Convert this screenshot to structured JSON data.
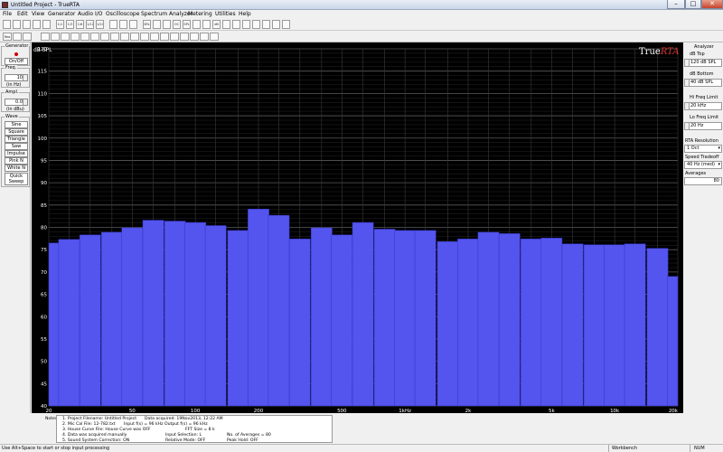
{
  "window": {
    "title": "Untitled Project - TrueRTA",
    "min": "–",
    "max": "□",
    "close": "✕"
  },
  "menu": [
    "File",
    "Edit",
    "View",
    "Generator",
    "Audio I/O",
    "Oscilloscope",
    "Spectrum Analyzer",
    "Metering",
    "Utilities",
    "Help"
  ],
  "toolbar": {
    "buttons": [
      "",
      "",
      "",
      "",
      "",
      "1/1",
      "1/3",
      "1/6",
      "1/12",
      "1/24",
      "",
      "",
      "",
      "SRL",
      "",
      "",
      "OC",
      "SPL",
      "",
      "",
      "dB",
      "",
      "",
      "",
      "",
      "",
      "",
      ""
    ],
    "buttons2": [
      "Rea"
    ]
  },
  "generator": {
    "label": "Generator",
    "onoff": "On/Off",
    "freq_label": "Freq.",
    "freq_value": "10",
    "freq_unit": "(in Hz)",
    "ampl_label": "Ampl.",
    "ampl_value": "0.0",
    "ampl_unit": "(in dBu)",
    "wave_label": "Wave",
    "waves": [
      "Sine",
      "Square",
      "Triangle",
      "Saw",
      "Impulse",
      "Pink N",
      "White N"
    ],
    "quick_sweep_1": "Quick",
    "quick_sweep_2": "Sweep"
  },
  "analyzer": {
    "label": "Analyzer",
    "db_top_label": "dB Top",
    "db_top": "120 dB SPL",
    "db_bottom_label": "dB Bottom",
    "db_bottom": "40 dB SPL",
    "hi_freq_label": "Hi Freq Limit",
    "hi_freq": "20 kHz",
    "lo_freq_label": "Lo Freq Limit",
    "lo_freq": "20 Hz",
    "resolution_label": "RTA Resolution",
    "resolution": "1 Oct",
    "speed_label": "Speed Tradeoff",
    "speed": "40 Hz (med)",
    "averages_label": "Averages",
    "averages": "80"
  },
  "chart_data": {
    "type": "bar",
    "brand_prefix": "True",
    "brand_suffix": "RTA",
    "ylabel": "dB SPL",
    "ylim": [
      40,
      120
    ],
    "xlim": [
      20,
      20000
    ],
    "x_scale": "log",
    "y_ticks": [
      "120",
      "115",
      "110",
      "105",
      "100",
      "95",
      "90",
      "85",
      "80",
      "75",
      "70",
      "65",
      "60",
      "55",
      "50",
      "45",
      "40"
    ],
    "x_ticks": [
      {
        "value": 20,
        "label": "20"
      },
      {
        "value": 50,
        "label": "50"
      },
      {
        "value": 100,
        "label": "100"
      },
      {
        "value": 200,
        "label": "200"
      },
      {
        "value": 500,
        "label": "500"
      },
      {
        "value": 1000,
        "label": "1kHz"
      },
      {
        "value": 2000,
        "label": "2k"
      },
      {
        "value": 5000,
        "label": "5k"
      },
      {
        "value": 10000,
        "label": "10k"
      },
      {
        "value": 20000,
        "label": "20k"
      }
    ],
    "bar_color": "#5454ee",
    "bars": [
      {
        "f": 20,
        "v": 76.5
      },
      {
        "f": 25,
        "v": 77.3
      },
      {
        "f": 31.5,
        "v": 78.3
      },
      {
        "f": 40,
        "v": 78.9
      },
      {
        "f": 50,
        "v": 79.9
      },
      {
        "f": 63,
        "v": 81.6
      },
      {
        "f": 80,
        "v": 81.4
      },
      {
        "f": 100,
        "v": 81.1
      },
      {
        "f": 125,
        "v": 80.4
      },
      {
        "f": 160,
        "v": 79.3
      },
      {
        "f": 200,
        "v": 84.1
      },
      {
        "f": 250,
        "v": 82.7
      },
      {
        "f": 315,
        "v": 77.4
      },
      {
        "f": 400,
        "v": 79.9
      },
      {
        "f": 500,
        "v": 78.3
      },
      {
        "f": 630,
        "v": 81.1
      },
      {
        "f": 800,
        "v": 79.6
      },
      {
        "f": 1000,
        "v": 79.3
      },
      {
        "f": 1250,
        "v": 79.3
      },
      {
        "f": 1600,
        "v": 76.8
      },
      {
        "f": 2000,
        "v": 77.4
      },
      {
        "f": 2500,
        "v": 78.9
      },
      {
        "f": 3150,
        "v": 78.6
      },
      {
        "f": 4000,
        "v": 77.4
      },
      {
        "f": 5000,
        "v": 77.6
      },
      {
        "f": 6300,
        "v": 76.3
      },
      {
        "f": 8000,
        "v": 76.1
      },
      {
        "f": 10000,
        "v": 76.1
      },
      {
        "f": 12500,
        "v": 76.3
      },
      {
        "f": 16000,
        "v": 75.3
      },
      {
        "f": 20000,
        "v": 69.0
      }
    ]
  },
  "notes": {
    "label": "Notes:",
    "lines": [
      "1. Project Filename: Untitled Project",
      "2. Mic Cal File: 12-782.txt",
      "3. House Curve File: House Curve was OFF",
      "4. Data was acquired manually",
      "5. Sound System Correction: ON"
    ],
    "col2": [
      "Data acquired: 19Nov2013, 12:22 AM",
      "Input f(s) = 96 kHz   Output f(s) = 96 kHz",
      "FFT Size = 8 k",
      "Input Selection: L",
      "Relative Mode: OFF"
    ],
    "col3": [
      "No. of Averages = 80",
      "Peak Hold: OFF"
    ]
  },
  "status": {
    "hint": "Use Alt+Space to start or stop input processing",
    "workbench": "Workbench",
    "num": "NUM"
  }
}
